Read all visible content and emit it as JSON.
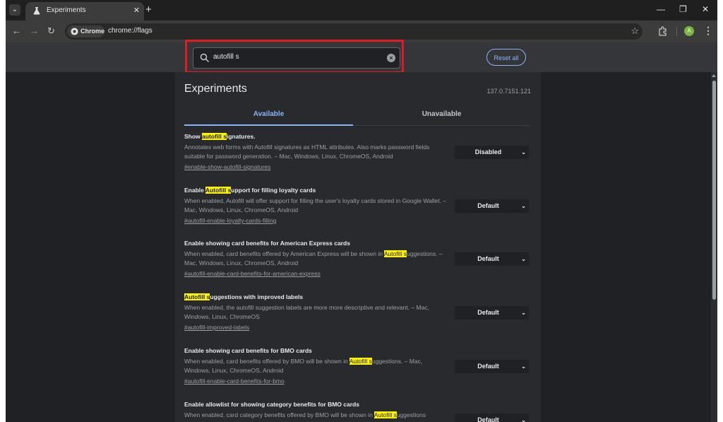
{
  "browser": {
    "tab_title": "Experiments",
    "tab_close_glyph": "✕",
    "new_tab_glyph": "+",
    "window_controls": {
      "minimize": "—",
      "restore": "❐",
      "close": "✕"
    },
    "nav": {
      "back": "←",
      "forward": "→",
      "reload": "↻"
    },
    "chip_label": "Chrome",
    "url": "chrome://flags",
    "star_glyph": "☆",
    "profile_initial": "A",
    "menu_glyph": "⋮"
  },
  "flags_page": {
    "search_value": "autofill s",
    "clear_glyph": "×",
    "reset_label": "Reset all",
    "title": "Experiments",
    "version": "137.0.7151.121",
    "tabs": {
      "available": "Available",
      "unavailable": "Unavailable"
    },
    "chevron_glyph": "⌄",
    "flags": [
      {
        "title": [
          {
            "t": "Show "
          },
          {
            "t": "autofill s",
            "hl": true
          },
          {
            "t": "ignatures."
          }
        ],
        "desc": [
          {
            "t": "Annotates web forms with Autofill signatures as HTML attributes. Also marks password fields suitable for password generation. – Mac, Windows, Linux, ChromeOS, Android"
          }
        ],
        "link": "#enable-show-autofill-signatures",
        "value": "Disabled"
      },
      {
        "title": [
          {
            "t": "Enable "
          },
          {
            "t": "Autofill s",
            "hl": true
          },
          {
            "t": "upport for filling loyalty cards"
          }
        ],
        "desc": [
          {
            "t": "When enabled, Autofill will offer support for filling the user's loyalty cards stored in Google Wallet. – Mac, Windows, Linux, ChromeOS, Android"
          }
        ],
        "link": "#autofill-enable-loyalty-cards-filling",
        "value": "Default"
      },
      {
        "title": [
          {
            "t": "Enable showing card benefits for American Express cards"
          }
        ],
        "desc": [
          {
            "t": "When enabled, card benefits offered by American Express will be shown in "
          },
          {
            "t": "Autofill s",
            "hl": true
          },
          {
            "t": "uggestions. – Mac, Windows, Linux, ChromeOS, Android"
          }
        ],
        "link": "#autofill-enable-card-benefits-for-american-express",
        "value": "Default"
      },
      {
        "title": [
          {
            "t": "Autofill s",
            "hl": true
          },
          {
            "t": "uggestions with improved labels"
          }
        ],
        "desc": [
          {
            "t": "When enabled, the autofill suggestion labels are more more descriptive and relevant. – Mac, Windows, Linux, ChromeOS"
          }
        ],
        "link": "#autofill-improved-labels",
        "value": "Default"
      },
      {
        "title": [
          {
            "t": "Enable showing card benefits for BMO cards"
          }
        ],
        "desc": [
          {
            "t": "When enabled, card benefits offered by BMO will be shown in "
          },
          {
            "t": "Autofill s",
            "hl": true
          },
          {
            "t": "uggestions. – Mac, Windows, Linux, ChromeOS, Android"
          }
        ],
        "link": "#autofill-enable-card-benefits-for-bmo",
        "value": "Default"
      },
      {
        "title": [
          {
            "t": "Enable allowlist for showing category benefits for BMO cards"
          }
        ],
        "desc": [
          {
            "t": "When enabled, card category benefits offered by BMO will be shown in "
          },
          {
            "t": "Autofill s",
            "hl": true
          },
          {
            "t": "uggestions"
          }
        ],
        "link": "",
        "value": "Default"
      }
    ]
  },
  "colors": {
    "accent": "#8ab4f8",
    "highlight": "#fff200",
    "annotation_box": "#e01b22"
  }
}
